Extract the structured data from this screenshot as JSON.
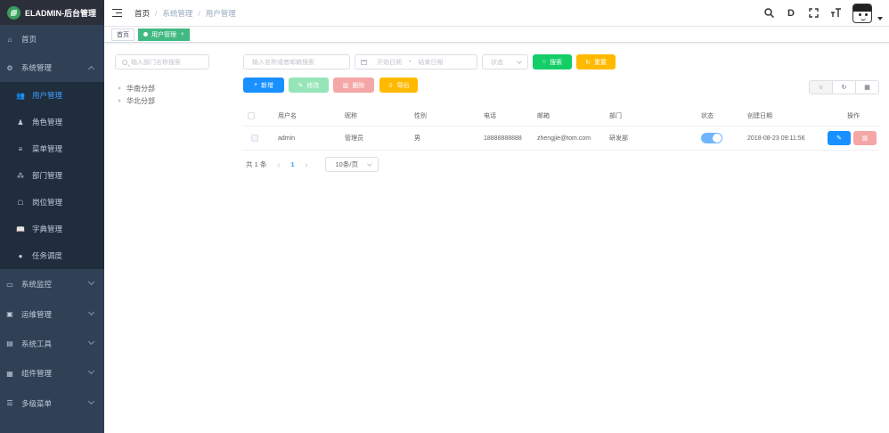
{
  "app": {
    "title": "ELADMIN-后台管理"
  },
  "sidebar": {
    "items": [
      {
        "label": "首页",
        "icon": "dashboard-icon"
      },
      {
        "label": "系统管理",
        "icon": "gear-icon",
        "expanded": true,
        "children": [
          {
            "label": "用户管理",
            "icon": "user-icon",
            "active": true
          },
          {
            "label": "角色管理",
            "icon": "role-icon"
          },
          {
            "label": "菜单管理",
            "icon": "menu-icon"
          },
          {
            "label": "部门管理",
            "icon": "dept-icon"
          },
          {
            "label": "岗位管理",
            "icon": "post-icon"
          },
          {
            "label": "字典管理",
            "icon": "dict-icon"
          },
          {
            "label": "任务调度",
            "icon": "timing-icon"
          }
        ]
      },
      {
        "label": "系统监控",
        "icon": "monitor-icon"
      },
      {
        "label": "运维管理",
        "icon": "ops-icon"
      },
      {
        "label": "系统工具",
        "icon": "tools-icon"
      },
      {
        "label": "组件管理",
        "icon": "components-icon"
      },
      {
        "label": "多级菜单",
        "icon": "multi-menu-icon"
      }
    ]
  },
  "navbar": {
    "breadcrumb": [
      "首页",
      "系统管理",
      "用户管理"
    ],
    "icons": [
      "search-icon",
      "doc-icon",
      "fullscreen-icon",
      "font-size-icon"
    ]
  },
  "tags": [
    {
      "label": "首页",
      "active": false
    },
    {
      "label": "用户管理",
      "active": true,
      "close": "×"
    }
  ],
  "dept_tree": {
    "search_placeholder": "输入部门名称搜索",
    "nodes": [
      "华南分部",
      "华北分部"
    ]
  },
  "filters": {
    "keyword_placeholder": "输入名称或者邮箱搜索",
    "date_start_placeholder": "开始日期",
    "date_sep": "-",
    "date_end_placeholder": "结束日期",
    "status_placeholder": "状态",
    "search_label": "搜索",
    "reset_label": "重置"
  },
  "actions": {
    "add_label": "新增",
    "edit_label": "修改",
    "delete_label": "删除",
    "export_label": "导出"
  },
  "table": {
    "columns": [
      "用户名",
      "昵称",
      "性别",
      "电话",
      "邮箱",
      "部门",
      "状态",
      "创建日期",
      "操作"
    ],
    "rows": [
      {
        "username": "admin",
        "nickname": "管理员",
        "gender": "男",
        "phone": "18888888888",
        "email": "zhengjie@tom.com",
        "dept": "研发部",
        "enabled": true,
        "created": "2018-08-23 09:11:56"
      }
    ]
  },
  "pagination": {
    "total_label": "共 1 条",
    "current_page": "1",
    "page_size": "10条/页"
  },
  "colors": {
    "sidebar_bg": "#304156",
    "active_menu": "#409eff",
    "tag_active": "#42b983",
    "primary": "#1890ff",
    "success": "#13ce66",
    "warning": "#ffba00"
  }
}
